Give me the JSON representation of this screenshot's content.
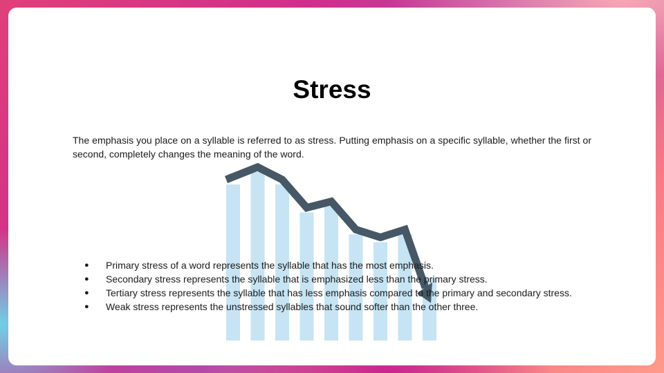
{
  "slide": {
    "title": "Stress",
    "intro": "The emphasis you place on a syllable is referred to as stress. Putting emphasis on a specific syllable, whether the first or second, completely changes the meaning of the word.",
    "bullets": [
      "Primary stress of a word represents the syllable that has the most emphasis.",
      "Secondary stress represents the syllable that is emphasized less than the primary stress.",
      "Tertiary stress represents the syllable that has less emphasis compared to the primary and secondary stress.",
      "Weak stress represents the unstressed syllables that sound softer than the other three."
    ],
    "bullet_glyph": "●"
  },
  "decoration": {
    "icon": "declining-bar-chart-icon",
    "bar_levels": [
      1.0,
      1.08,
      1.0,
      0.82,
      0.86,
      0.68,
      0.63,
      0.68,
      0.4
    ],
    "bar_color": "#c6e4f3",
    "line_color": "#465866"
  }
}
